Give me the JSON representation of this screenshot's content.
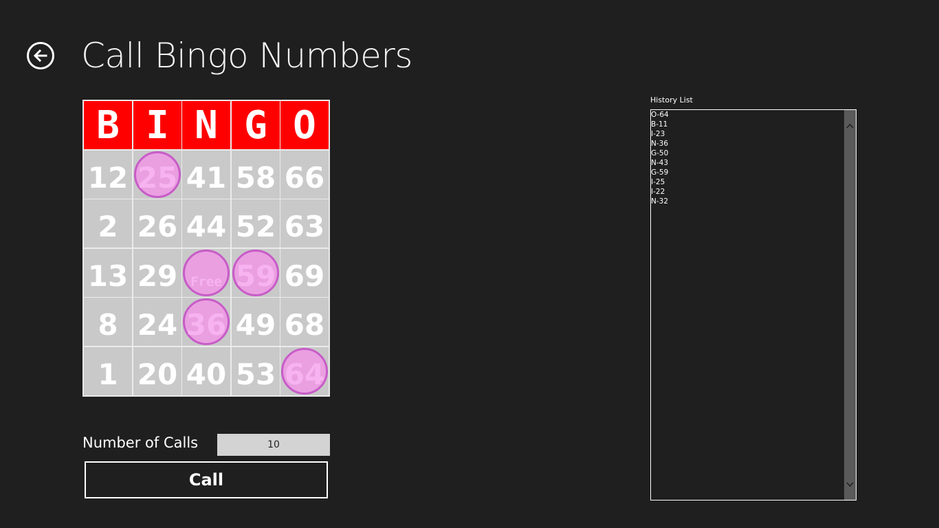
{
  "page": {
    "title": "Call Bingo Numbers"
  },
  "card": {
    "header": [
      "B",
      "I",
      "N",
      "G",
      "O"
    ],
    "rows": [
      [
        "12",
        "25",
        "41",
        "58",
        "66"
      ],
      [
        "2",
        "26",
        "44",
        "52",
        "63"
      ],
      [
        "13",
        "29",
        "Free",
        "59",
        "69"
      ],
      [
        "8",
        "24",
        "36",
        "49",
        "68"
      ],
      [
        "1",
        "20",
        "40",
        "53",
        "64"
      ]
    ],
    "marked": [
      "25",
      "Free",
      "59",
      "36",
      "64"
    ],
    "colors": {
      "header_bg": "#ff0000",
      "cell_bg": "#c9c9c9",
      "dauber_fill": "#ee99e4",
      "dauber_ring": "#c75cc7"
    }
  },
  "calls": {
    "label": "Number of Calls",
    "value": "10",
    "button_label": "Call"
  },
  "history": {
    "label": "History List",
    "items": [
      "O-64",
      "B-11",
      "I-23",
      "N-36",
      "G-50",
      "N-43",
      "G-59",
      "I-25",
      "I-22",
      "N-32"
    ]
  },
  "icons": {
    "back": "back-arrow-icon",
    "scroll_up": "chevron-up-icon",
    "scroll_down": "chevron-down-icon"
  }
}
